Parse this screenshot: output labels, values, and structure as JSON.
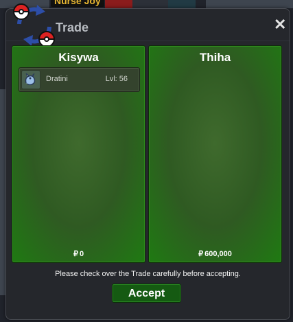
{
  "background": {
    "npc_label": "Nurse Joy"
  },
  "window": {
    "title": "Trade",
    "close_icon": "close-icon",
    "logo_icon": "pokeball-swap-icon"
  },
  "trade": {
    "left": {
      "player_name": "Kisywa",
      "currency_symbol": "₽",
      "money": "0",
      "pokemon": [
        {
          "name": "Dratini",
          "level_text": "Lvl: 56",
          "icon": "dratini-sprite-icon"
        }
      ]
    },
    "right": {
      "player_name": "Thiha",
      "currency_symbol": "₽",
      "money": "600,000",
      "pokemon": []
    }
  },
  "footer": {
    "notice": "Please check over the Trade carefully before accepting.",
    "accept_label": "Accept"
  },
  "colors": {
    "panel_green": "#2f5a22",
    "accept_green": "#155a12",
    "window_bg": "#25272c"
  }
}
